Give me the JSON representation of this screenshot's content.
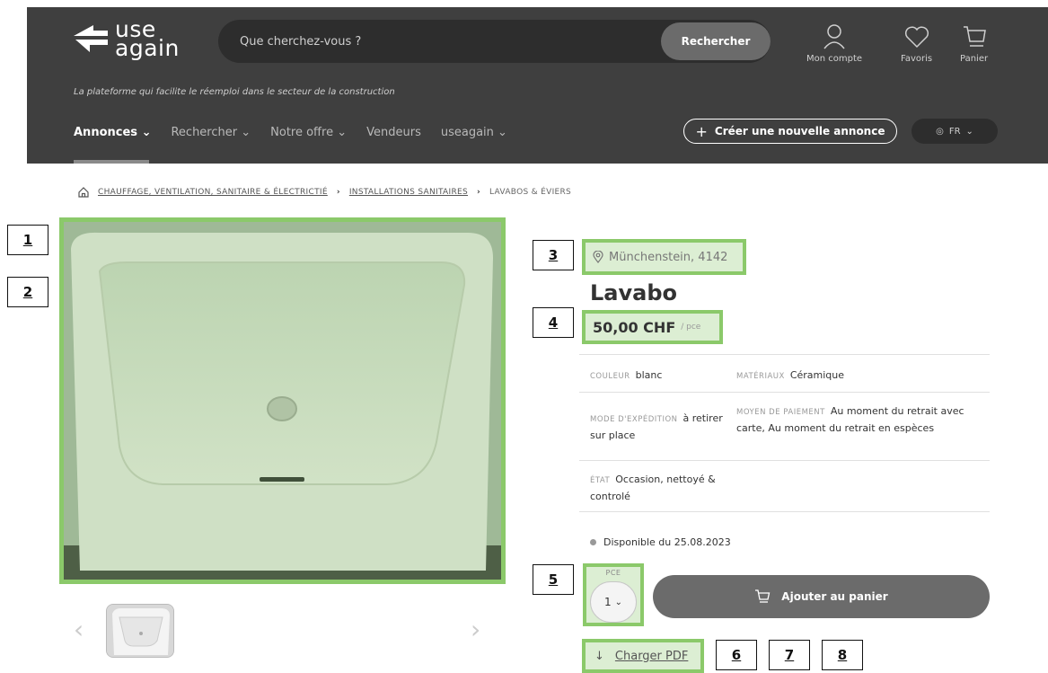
{
  "brand": {
    "logo_line1": "use",
    "logo_line2": "again",
    "tagline": "La plateforme qui facilite le réemploi dans le secteur de la construction"
  },
  "search": {
    "placeholder": "Que cherchez-vous ?",
    "button_label": "Rechercher"
  },
  "header_links": {
    "account": "Mon compte",
    "favorites": "Favoris",
    "cart": "Panier"
  },
  "nav": {
    "items": [
      "Annonces",
      "Rechercher",
      "Notre offre",
      "Vendeurs",
      "useagain"
    ],
    "create_listing": "Créer une nouvelle annonce",
    "language": "FR"
  },
  "breadcrumb": {
    "items": [
      "CHAUFFAGE, VENTILATION, SANITAIRE & ÉLECTRICTIÉ",
      "INSTALLATIONS SANITAIRES"
    ],
    "current": "LAVABOS & ÉVIERS"
  },
  "annotations": [
    "1",
    "2",
    "3",
    "4",
    "5",
    "6",
    "7",
    "8"
  ],
  "product": {
    "location": "Münchenstein, 4142",
    "title": "Lavabo",
    "price": "50,00 CHF",
    "price_unit": "/ pce",
    "properties": {
      "color_label": "COULEUR",
      "color_value": "blanc",
      "material_label": "MATÉRIAUX",
      "material_value": "Céramique",
      "shipping_label": "MODE D'EXPÉDITION",
      "shipping_value": "à retirer sur place",
      "payment_label": "MOYEN DE PAIEMENT",
      "payment_value": "Au moment du retrait avec carte, Au moment du retrait en espèces",
      "condition_label": "ÉTAT",
      "condition_value": "Occasion, nettoyé & controlé"
    },
    "availability": "Disponible du 25.08.2023",
    "quantity_label": "PCE",
    "quantity_value": "1",
    "add_to_cart": "Ajouter au panier",
    "download_pdf": "Charger PDF"
  },
  "colors": {
    "header_bg": "#3f3f3f",
    "highlight": "#8bc96a",
    "highlight_fill": "#dceed3",
    "button_bg": "#6b6b6b"
  }
}
